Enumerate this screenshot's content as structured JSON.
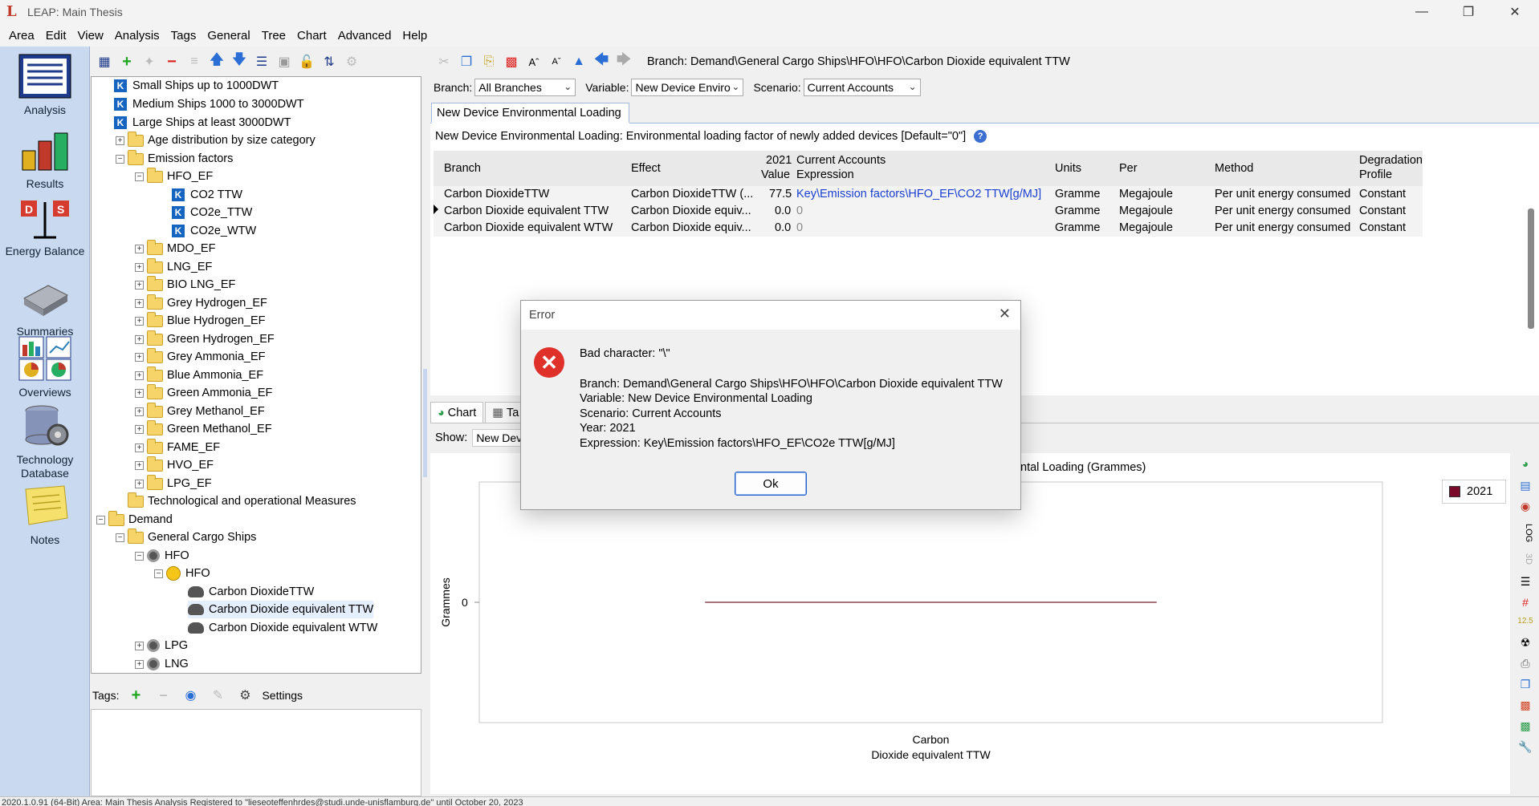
{
  "window": {
    "title": "LEAP: Main Thesis",
    "logo": "L"
  },
  "menu": [
    "Area",
    "Edit",
    "View",
    "Analysis",
    "Tags",
    "General",
    "Tree",
    "Chart",
    "Advanced",
    "Help"
  ],
  "nav": [
    {
      "label": "Analysis",
      "icon": "analysis-icon"
    },
    {
      "label": "Results",
      "icon": "results-icon"
    },
    {
      "label": "Energy Balance",
      "icon": "energy-balance-icon"
    },
    {
      "label": "Summaries",
      "icon": "summaries-icon"
    },
    {
      "label": "Overviews",
      "icon": "overviews-icon"
    },
    {
      "label": "Technology Database",
      "icon": "technology-database-icon"
    },
    {
      "label": "Notes",
      "icon": "notes-icon"
    }
  ],
  "tree": [
    {
      "label": "Small Ships up to 1000DWT",
      "kind": "key"
    },
    {
      "label": "Medium Ships 1000 to 3000DWT",
      "kind": "key"
    },
    {
      "label": "Large Ships at least 3000DWT",
      "kind": "key"
    },
    {
      "label": "Age distribution by size category",
      "kind": "folder"
    },
    {
      "label": "Emission factors",
      "kind": "folder"
    },
    {
      "label": "HFO_EF",
      "kind": "folder"
    },
    {
      "label": "CO2 TTW",
      "kind": "key"
    },
    {
      "label": "CO2e_TTW",
      "kind": "key"
    },
    {
      "label": "CO2e_WTW",
      "kind": "key"
    },
    {
      "label": "MDO_EF",
      "kind": "folder"
    },
    {
      "label": "LNG_EF",
      "kind": "folder"
    },
    {
      "label": "BIO LNG_EF",
      "kind": "folder"
    },
    {
      "label": "Grey Hydrogen_EF",
      "kind": "folder"
    },
    {
      "label": "Blue Hydrogen_EF",
      "kind": "folder"
    },
    {
      "label": "Green Hydrogen_EF",
      "kind": "folder"
    },
    {
      "label": "Grey Ammonia_EF",
      "kind": "folder"
    },
    {
      "label": "Blue Ammonia_EF",
      "kind": "folder"
    },
    {
      "label": "Green Ammonia_EF",
      "kind": "folder"
    },
    {
      "label": "Grey Methanol_EF",
      "kind": "folder"
    },
    {
      "label": "Green Methanol_EF",
      "kind": "folder"
    },
    {
      "label": "FAME_EF",
      "kind": "folder"
    },
    {
      "label": "HVO_EF",
      "kind": "folder"
    },
    {
      "label": "LPG_EF",
      "kind": "folder"
    },
    {
      "label": "Technological and operational Measures",
      "kind": "folder"
    },
    {
      "label": "Demand",
      "kind": "folder"
    },
    {
      "label": "General Cargo Ships",
      "kind": "folder"
    },
    {
      "label": "HFO",
      "kind": "gear"
    },
    {
      "label": "HFO",
      "kind": "sun"
    },
    {
      "label": "Carbon DioxideTTW",
      "kind": "cloud"
    },
    {
      "label": "Carbon Dioxide equivalent TTW",
      "kind": "cloud",
      "selected": true
    },
    {
      "label": "Carbon Dioxide equivalent WTW",
      "kind": "cloud"
    },
    {
      "label": "LPG",
      "kind": "gear"
    },
    {
      "label": "LNG",
      "kind": "gear"
    }
  ],
  "tags": {
    "label": "Tags:",
    "settings": "Settings"
  },
  "toolbar": {
    "branch_path": "Branch: Demand\\General Cargo Ships\\HFO\\HFO\\Carbon Dioxide equivalent TTW"
  },
  "filters": {
    "branch_label": "Branch:",
    "branch_value": "All Branches",
    "variable_label": "Variable:",
    "variable_value": "New Device Enviro",
    "scenario_label": "Scenario:",
    "scenario_value": "Current Accounts"
  },
  "variable_tab": "New Device Environmental Loading",
  "variable_description": "New Device Environmental Loading: Environmental loading factor of newly added devices [Default=\"0\"]",
  "grid": {
    "headers": {
      "branch": "Branch",
      "effect": "Effect",
      "value_top": "2021",
      "value_bottom": "Value",
      "expr_top": "Current Accounts",
      "expr_bottom": "Expression",
      "units": "Units",
      "per": "Per",
      "method": "Method",
      "degr_top": "Degradation",
      "degr_bottom": "Profile"
    },
    "rows": [
      {
        "branch": "Carbon DioxideTTW",
        "effect": "Carbon DioxideTTW (...",
        "value": "77.5",
        "expression": "Key\\Emission factors\\HFO_EF\\CO2 TTW[g/MJ]",
        "units": "Gramme",
        "per": "Megajoule",
        "method": "Per unit energy consumed",
        "profile": "Constant"
      },
      {
        "branch": "Carbon Dioxide equivalent TTW",
        "effect": "Carbon Dioxide equiv...",
        "value": "0.0",
        "expression": "0",
        "units": "Gramme",
        "per": "Megajoule",
        "method": "Per unit energy consumed",
        "profile": "Constant"
      },
      {
        "branch": "Carbon Dioxide equivalent WTW",
        "effect": "Carbon Dioxide equiv...",
        "value": "0.0",
        "expression": "0",
        "units": "Gramme",
        "per": "Megajoule",
        "method": "Per unit energy consumed",
        "profile": "Constant"
      }
    ]
  },
  "chart_tabs": [
    "Chart",
    "Ta"
  ],
  "show": {
    "label": "Show:",
    "value": "New Dev"
  },
  "chart_data": {
    "type": "line",
    "title": "ntal Loading (Grammes)",
    "ylabel": "Grammes",
    "categories": [
      "Carbon Dioxide equivalent TTW"
    ],
    "category_lines": [
      "Carbon",
      "Dioxide equivalent TTW"
    ],
    "yticks": [
      "0"
    ],
    "series": [
      {
        "name": "2021",
        "values": [
          0
        ]
      }
    ],
    "legend_position": "top-right",
    "colors": {
      "series": "#7a0a2a",
      "line": "#a8737d"
    }
  },
  "dialog": {
    "title": "Error",
    "message": "Bad character: \"\\\"",
    "details": [
      "Branch: Demand\\General Cargo Ships\\HFO\\HFO\\Carbon Dioxide equivalent TTW",
      "Variable: New Device Environmental Loading",
      "Scenario: Current Accounts",
      "Year: 2021",
      "Expression: Key\\Emission factors\\HFO_EF\\CO2e TTW[g/MJ]"
    ],
    "ok_label": "Ok"
  },
  "status": "2020.1.0.91 (64-Bit)    Area: Main Thesis    Analysis    Registered to \"lieseoteffenhrdes@studi.unde-unisflamburg.de\" until October 20, 2023"
}
